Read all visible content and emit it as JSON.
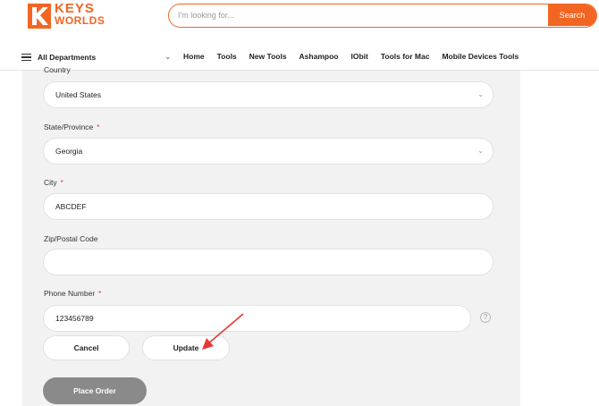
{
  "header": {
    "logo_line1": "KEYS",
    "logo_line2": "WORLDS",
    "search": {
      "placeholder": "I'm looking for...",
      "button_label": "Search"
    }
  },
  "nav": {
    "departments_label": "All Departments",
    "links": [
      "Home",
      "Tools",
      "New Tools",
      "Ashampoo",
      "IObit",
      "Tools for Mac",
      "Mobile Devices Tools"
    ]
  },
  "form": {
    "country": {
      "label": "Country",
      "value": "United States"
    },
    "state": {
      "label": "State/Province",
      "required_mark": "*",
      "value": "Georgia"
    },
    "city": {
      "label": "City",
      "required_mark": "*",
      "value": "ABCDEF"
    },
    "zip": {
      "label": "Zip/Postal Code",
      "value": ""
    },
    "phone": {
      "label": "Phone Number",
      "required_mark": "*",
      "value": "123456789",
      "help": "?"
    },
    "cancel_label": "Cancel",
    "update_label": "Update",
    "place_order_label": "Place Order"
  },
  "colors": {
    "brand_orange": "#f26522",
    "annotation_red": "#e53935",
    "panel_gray": "#f2f2f2"
  },
  "icons": [
    "logo-k-icon",
    "hamburger-icon",
    "chevron-down-icon",
    "select-arrow-icon",
    "help-icon",
    "annotation-arrow-icon"
  ]
}
